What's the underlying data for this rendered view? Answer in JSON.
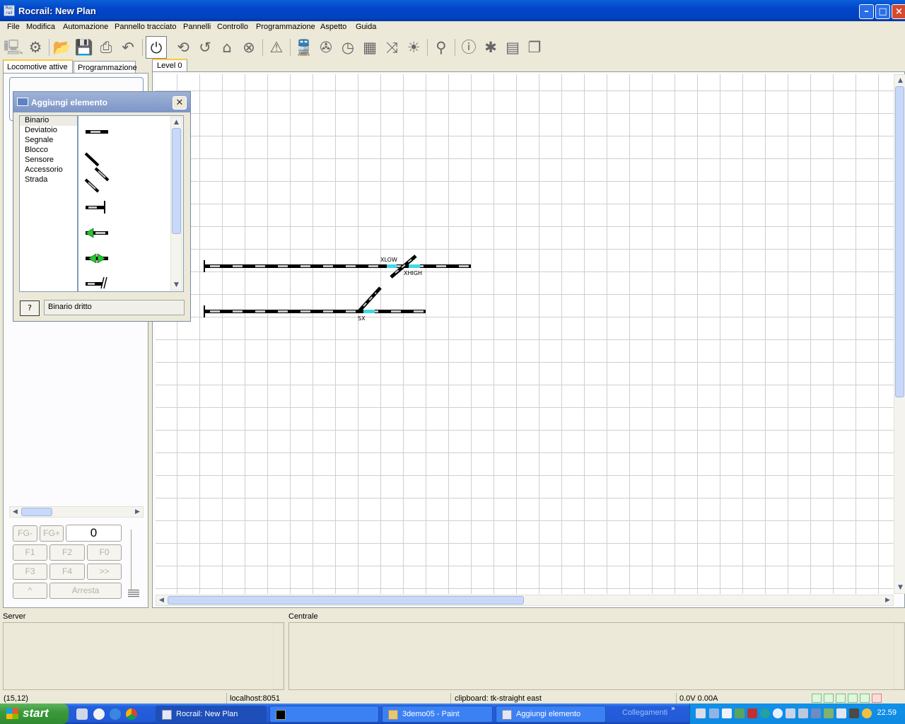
{
  "window": {
    "title": "Rocrail: New Plan",
    "app_icon_text": "Roc rail"
  },
  "menu": [
    "File",
    "Modifica",
    "Automazione",
    "Pannello tracciato",
    "Pannelli",
    "Controllo",
    "Programmazione",
    "Aspetto",
    "Guida"
  ],
  "toolbar_icons": [
    "connect-icon",
    "settings-icon",
    "open-icon",
    "save-icon",
    "print-icon",
    "undo-icon",
    "power-icon",
    "cycle-icon",
    "reset-icon",
    "home-icon",
    "stop-all-icon",
    "warning-icon",
    "locomotive-icon",
    "wrench-icon",
    "speedometer-icon",
    "route-icon",
    "shuffle-icon",
    "light-icon",
    "zoom-icon",
    "info-icon",
    "bug-icon",
    "document-icon",
    "pages-icon"
  ],
  "left_tabs": {
    "active": "Locomotive attive",
    "other": "Programmazione"
  },
  "throttle": {
    "fg_minus": "FG-",
    "fg_plus": "FG+",
    "speed": "0",
    "f1": "F1",
    "f2": "F2",
    "f0": "F0",
    "f3": "F3",
    "f4": "F4",
    "more": ">>",
    "dir": "^",
    "stop": "Arresta"
  },
  "level_tab": "Level 0",
  "track_labels": {
    "xlow": "XLOW",
    "xhigh": "XHIGH",
    "sx": "SX"
  },
  "dialog": {
    "title": "Aggiungi elemento",
    "categories": [
      "Binario",
      "Deviatoio",
      "Segnale",
      "Blocco",
      "Sensore",
      "Accessorio",
      "Strada"
    ],
    "selected": "Binario",
    "help_button": "?",
    "description": "Binario dritto"
  },
  "panes": {
    "server": "Server",
    "centrale": "Centrale"
  },
  "status": {
    "coords": "(15,12)",
    "host": "localhost:8051",
    "clipboard": "clipboard: tk-straight east",
    "power": "0.0V 0.00A"
  },
  "taskbar": {
    "start": "start",
    "tasks": [
      {
        "label": "Rocrail: New Plan",
        "active": true
      },
      {
        "label": "",
        "active": false
      },
      {
        "label": "3demo05 - Paint",
        "active": false
      },
      {
        "label": "Aggiungi elemento",
        "active": false
      }
    ],
    "links": "Collegamenti",
    "clock": "22.59"
  },
  "colors": {
    "accent": "#0046c8",
    "occupied": "#40d8e8",
    "signal_green": "#21c92b",
    "track": "#000000",
    "tie": "#c8c8c8"
  }
}
